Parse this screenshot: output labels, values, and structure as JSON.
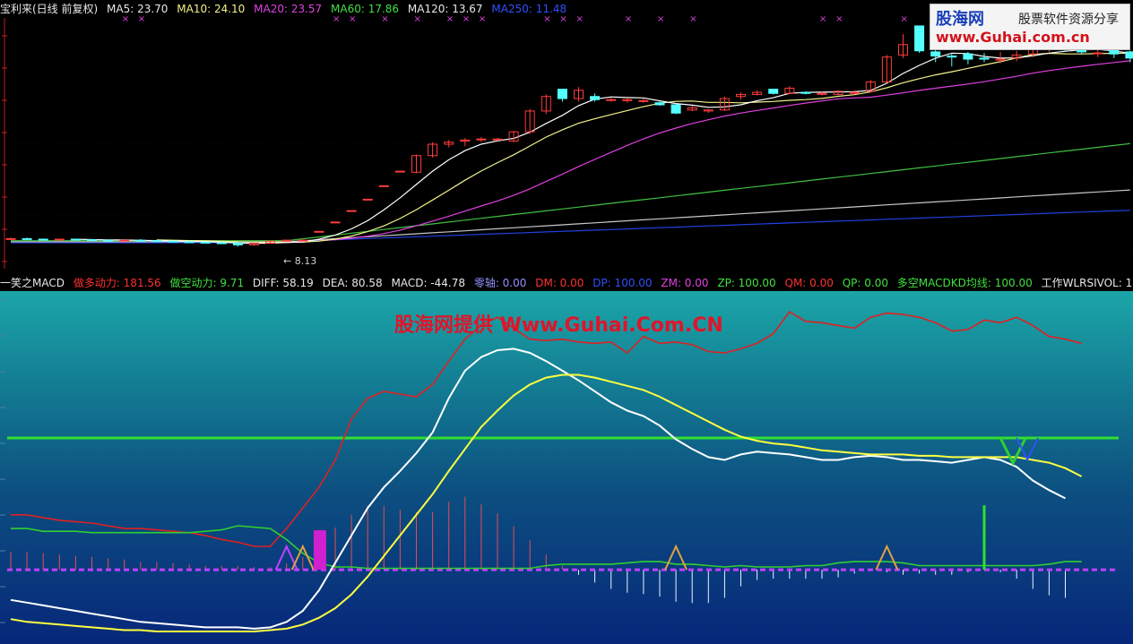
{
  "top_header": [
    {
      "text": "宝利来(日线 前复权)",
      "color": "#e8e8e8"
    },
    {
      "text": "MA5: 23.70",
      "color": "#e8e8e8"
    },
    {
      "text": "MA10: 24.10",
      "color": "#f2f28a"
    },
    {
      "text": "MA20: 23.57",
      "color": "#e040e0"
    },
    {
      "text": "MA60: 17.86",
      "color": "#40e040"
    },
    {
      "text": "MA120: 13.67",
      "color": "#e8e8e8"
    },
    {
      "text": "MA250: 11.48",
      "color": "#3050ff"
    }
  ],
  "bottom_header": [
    {
      "text": "一笑之MACD",
      "color": "#e8e8e8"
    },
    {
      "text": "做多动力: 181.56",
      "color": "#ff3030"
    },
    {
      "text": "做空动力: 9.71",
      "color": "#40e040"
    },
    {
      "text": "DIFF: 58.19",
      "color": "#e8e8e8"
    },
    {
      "text": "DEA: 80.58",
      "color": "#e8e8e8"
    },
    {
      "text": "MACD: -44.78",
      "color": "#e8e8e8"
    },
    {
      "text": "零轴: 0.00",
      "color": "#9090ff"
    },
    {
      "text": "DM: 0.00",
      "color": "#ff3030"
    },
    {
      "text": "DP: 100.00",
      "color": "#3050ff"
    },
    {
      "text": "ZM: 0.00",
      "color": "#e040e0"
    },
    {
      "text": "ZP: 100.00",
      "color": "#40e040"
    },
    {
      "text": "QM: 0.00",
      "color": "#ff3030"
    },
    {
      "text": "QP: 0.00",
      "color": "#40e040"
    },
    {
      "text": "多空MACDKD均线: 100.00",
      "color": "#40e040"
    },
    {
      "text": "工作WLRSIVOL: 100.00",
      "color": "#e8e8e8"
    }
  ],
  "logo": {
    "name": "股海网",
    "slogan": "股票软件资源分享",
    "url": "www.Guhai.com.cn"
  },
  "watermark": "股海网提供 Www.Guhai.Com.CN",
  "price_min_label": "8.13",
  "colors": {
    "up": "#ff3c3c",
    "down": "#54ffff",
    "ma5": "#ffffff",
    "ma10": "#f2f28a",
    "ma20": "#e040e0",
    "ma60": "#40c040",
    "ma120": "#c8c8c8",
    "ma250": "#2040e0",
    "diff": "#ffffff",
    "dea": "#ffff40",
    "bull": "#e02020",
    "bear": "#30d030",
    "zero": "#c040ff",
    "ref": "#30e030"
  },
  "chart_data": [
    {
      "type": "candlestick",
      "title": "宝利来(日线 前复权)",
      "ylim": [
        6,
        30
      ],
      "candles": [
        [
          8.9,
          9.0,
          8.8,
          8.9
        ],
        [
          8.9,
          9.0,
          8.8,
          8.85
        ],
        [
          8.85,
          8.9,
          8.7,
          8.8
        ],
        [
          8.8,
          8.9,
          8.7,
          8.85
        ],
        [
          8.85,
          8.9,
          8.75,
          8.8
        ],
        [
          8.8,
          8.85,
          8.7,
          8.75
        ],
        [
          8.75,
          8.8,
          8.65,
          8.7
        ],
        [
          8.7,
          8.8,
          8.6,
          8.75
        ],
        [
          8.75,
          8.85,
          8.65,
          8.7
        ],
        [
          8.7,
          8.8,
          8.6,
          8.65
        ],
        [
          8.65,
          8.7,
          8.55,
          8.6
        ],
        [
          8.6,
          8.7,
          8.5,
          8.55
        ],
        [
          8.55,
          8.6,
          8.45,
          8.5
        ],
        [
          8.5,
          8.6,
          8.4,
          8.45
        ],
        [
          8.45,
          8.55,
          8.13,
          8.3
        ],
        [
          8.3,
          8.5,
          8.2,
          8.45
        ],
        [
          8.45,
          8.7,
          8.4,
          8.65
        ],
        [
          8.65,
          8.8,
          8.6,
          8.75
        ],
        [
          8.75,
          8.8,
          8.7,
          8.75
        ],
        [
          9.6,
          9.6,
          9.6,
          9.6
        ],
        [
          10.5,
          10.5,
          10.5,
          10.5
        ],
        [
          11.6,
          11.6,
          11.6,
          11.6
        ],
        [
          12.7,
          12.7,
          12.7,
          12.7
        ],
        [
          14.0,
          14.0,
          14.0,
          14.0
        ],
        [
          15.4,
          15.4,
          15.4,
          15.4
        ],
        [
          15.3,
          17.0,
          15.2,
          16.9
        ],
        [
          16.9,
          18.2,
          16.7,
          18.0
        ],
        [
          18.0,
          18.4,
          17.7,
          18.2
        ],
        [
          18.3,
          18.6,
          17.8,
          18.4
        ],
        [
          18.5,
          18.7,
          18.2,
          18.5
        ],
        [
          18.5,
          18.6,
          18.3,
          18.5
        ],
        [
          18.3,
          19.3,
          18.2,
          19.2
        ],
        [
          19.2,
          21.4,
          19.0,
          21.2
        ],
        [
          21.2,
          22.8,
          20.9,
          22.6
        ],
        [
          23.3,
          23.3,
          22.1,
          22.4
        ],
        [
          22.4,
          23.5,
          22.1,
          23.2
        ],
        [
          22.6,
          22.9,
          22.1,
          22.3
        ],
        [
          22.3,
          22.5,
          22.1,
          22.3
        ],
        [
          22.2,
          22.5,
          22.0,
          22.3
        ],
        [
          22.2,
          22.4,
          22.0,
          22.2
        ],
        [
          22.0,
          22.1,
          21.7,
          21.8
        ],
        [
          21.8,
          21.9,
          20.9,
          21.0
        ],
        [
          21.3,
          21.7,
          21.2,
          21.5
        ],
        [
          21.2,
          21.4,
          21.0,
          21.3
        ],
        [
          21.3,
          22.6,
          21.2,
          22.4
        ],
        [
          22.6,
          23.0,
          22.3,
          22.8
        ],
        [
          22.8,
          23.2,
          22.7,
          23.0
        ],
        [
          23.3,
          23.3,
          22.8,
          22.9
        ],
        [
          22.9,
          23.6,
          22.8,
          23.4
        ],
        [
          23.0,
          23.1,
          22.8,
          22.9
        ],
        [
          22.8,
          23.1,
          22.7,
          22.9
        ],
        [
          22.8,
          23.2,
          22.7,
          23.1
        ],
        [
          22.9,
          23.2,
          22.8,
          23.0
        ],
        [
          23.1,
          24.2,
          23.0,
          24.0
        ],
        [
          24.0,
          26.6,
          23.9,
          26.4
        ],
        [
          26.6,
          28.6,
          26.3,
          27.6
        ],
        [
          29.4,
          29.4,
          26.8,
          27.0
        ],
        [
          26.9,
          27.7,
          25.9,
          26.5
        ],
        [
          26.5,
          26.8,
          25.5,
          26.4
        ],
        [
          26.7,
          26.9,
          25.7,
          26.2
        ],
        [
          26.3,
          26.8,
          25.9,
          26.2
        ],
        [
          26.1,
          26.9,
          25.8,
          26.2
        ],
        [
          26.3,
          27.0,
          26.0,
          26.6
        ],
        [
          26.7,
          27.6,
          26.4,
          27.4
        ],
        [
          27.2,
          27.9,
          26.9,
          27.5
        ],
        [
          27.4,
          27.6,
          26.9,
          27.1
        ],
        [
          27.2,
          27.5,
          26.7,
          26.9
        ],
        [
          26.8,
          27.2,
          26.4,
          26.8
        ],
        [
          27.2,
          27.6,
          26.3,
          26.7
        ],
        [
          26.9,
          27.0,
          25.9,
          26.3
        ]
      ]
    },
    {
      "type": "line",
      "title": "一笑之MACD",
      "ylim": [
        -45,
        190
      ],
      "series": [
        {
          "name": "做多动力",
          "values": [
            40,
            40,
            38,
            36,
            35,
            34,
            32,
            30,
            30,
            29,
            28,
            27,
            25,
            22,
            20,
            17,
            17,
            30,
            45,
            60,
            80,
            110,
            125,
            130,
            128,
            126,
            135,
            152,
            168,
            178,
            184,
            176,
            168,
            167,
            168,
            166,
            165,
            166,
            158,
            170,
            165,
            166,
            164,
            159,
            158,
            161,
            165,
            172,
            188,
            181,
            180,
            178,
            176,
            184,
            187,
            186,
            184,
            180,
            174,
            175,
            182,
            180,
            184,
            178,
            170,
            168,
            165
          ]
        },
        {
          "name": "做空动力",
          "values": [
            30,
            30,
            28,
            28,
            28,
            27,
            27,
            27,
            27,
            27,
            27,
            27,
            28,
            29,
            32,
            31,
            30,
            22,
            12,
            5,
            2,
            2,
            1,
            1,
            1,
            1,
            1,
            1,
            1,
            1,
            1,
            1,
            1,
            3,
            4,
            4,
            4,
            4,
            5,
            6,
            6,
            4,
            4,
            3,
            2,
            3,
            2,
            2,
            2,
            3,
            3,
            5,
            6,
            6,
            6,
            5,
            3,
            3,
            3,
            3,
            3,
            3,
            3,
            3,
            4,
            6,
            6
          ]
        },
        {
          "name": "DIFF",
          "values": [
            -22,
            -24,
            -26,
            -28,
            -30,
            -32,
            -34,
            -36,
            -38,
            -39,
            -40,
            -41,
            -42,
            -42,
            -42,
            -43,
            -42,
            -38,
            -30,
            -15,
            5,
            25,
            45,
            60,
            72,
            85,
            100,
            125,
            145,
            155,
            160,
            161,
            158,
            152,
            145,
            138,
            130,
            122,
            116,
            112,
            105,
            95,
            88,
            82,
            80,
            84,
            86,
            85,
            84,
            82,
            80,
            80,
            82,
            83,
            82,
            80,
            80,
            79,
            78,
            80,
            82,
            80,
            75,
            65,
            58,
            52
          ]
        },
        {
          "name": "DEA",
          "values": [
            -36,
            -38,
            -39,
            -40,
            -41,
            -42,
            -43,
            -44,
            -44,
            -45,
            -45,
            -45,
            -45,
            -45,
            -45,
            -45,
            -44,
            -43,
            -40,
            -35,
            -28,
            -18,
            -5,
            10,
            25,
            40,
            55,
            72,
            88,
            104,
            116,
            127,
            135,
            140,
            142,
            142,
            140,
            137,
            134,
            131,
            126,
            120,
            114,
            108,
            102,
            97,
            94,
            92,
            91,
            89,
            87,
            86,
            85,
            84,
            84,
            84,
            83,
            83,
            82,
            82,
            82,
            82,
            82,
            80,
            78,
            74,
            68
          ]
        }
      ]
    }
  ]
}
